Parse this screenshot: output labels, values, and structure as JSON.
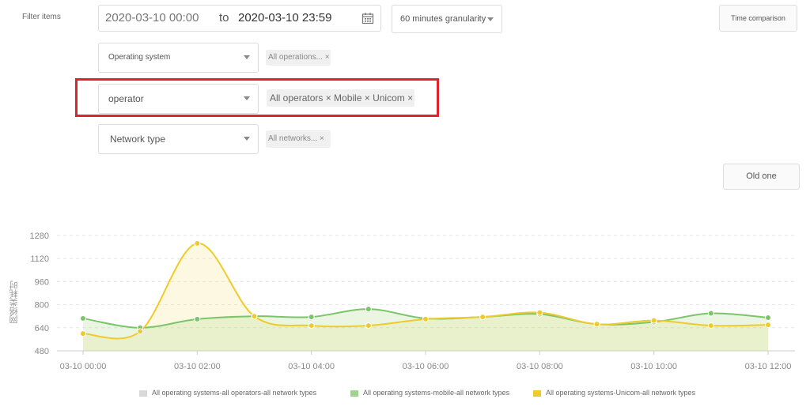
{
  "filters": {
    "label": "Filter items",
    "date_start": "2020-03-10 00:00",
    "date_separator": "to",
    "date_end": "2020-03-10 23:59",
    "granularity": "60 minutes granularity",
    "time_comparison": "Time comparison",
    "operating_system": {
      "placeholder": "Operating system",
      "tag": "All operations... ×"
    },
    "operator": {
      "value": "operator",
      "tag": "All operators × Mobile × Unicom ×"
    },
    "network_type": {
      "placeholder": "Network type",
      "tag": "All networks... ×"
    },
    "old_one": "Old one"
  },
  "colors": {
    "green": "#7cc46a",
    "yellow": "#eecb2c",
    "gray": "#d8d8d8",
    "highlight": "#e0232a"
  },
  "chart_data": {
    "type": "line",
    "ylabel": "网络类耗时",
    "ylim": [
      480,
      1280
    ],
    "yticks": [
      480,
      640,
      800,
      960,
      1120,
      1280
    ],
    "x": [
      "03-10 00:00",
      "03-10 01:00",
      "03-10 02:00",
      "03-10 03:00",
      "03-10 04:00",
      "03-10 05:00",
      "03-10 06:00",
      "03-10 07:00",
      "03-10 08:00",
      "03-10 09:00",
      "03-10 10:00",
      "03-10 11:00",
      "03-10 12:00"
    ],
    "xtick_labels": [
      "03-10 00:00",
      "03-10 02:00",
      "03-10 04:00",
      "03-10 06:00",
      "03-10 08:00",
      "03-10 10:00",
      "03-10 12:00"
    ],
    "series": [
      {
        "name": "All operating systems-all operators-all network types",
        "color": "#d8d8d8",
        "values": []
      },
      {
        "name": "All operating systems-mobile-all network types",
        "color": "#7cc46a",
        "values": [
          705,
          640,
          700,
          720,
          715,
          770,
          705,
          715,
          735,
          665,
          680,
          740,
          710
        ]
      },
      {
        "name": "All operating systems-Unicom-all network types",
        "color": "#eecb2c",
        "values": [
          600,
          615,
          1225,
          720,
          655,
          655,
          700,
          715,
          745,
          665,
          690,
          655,
          660
        ]
      }
    ],
    "legend_position": "bottom",
    "grid": true
  }
}
